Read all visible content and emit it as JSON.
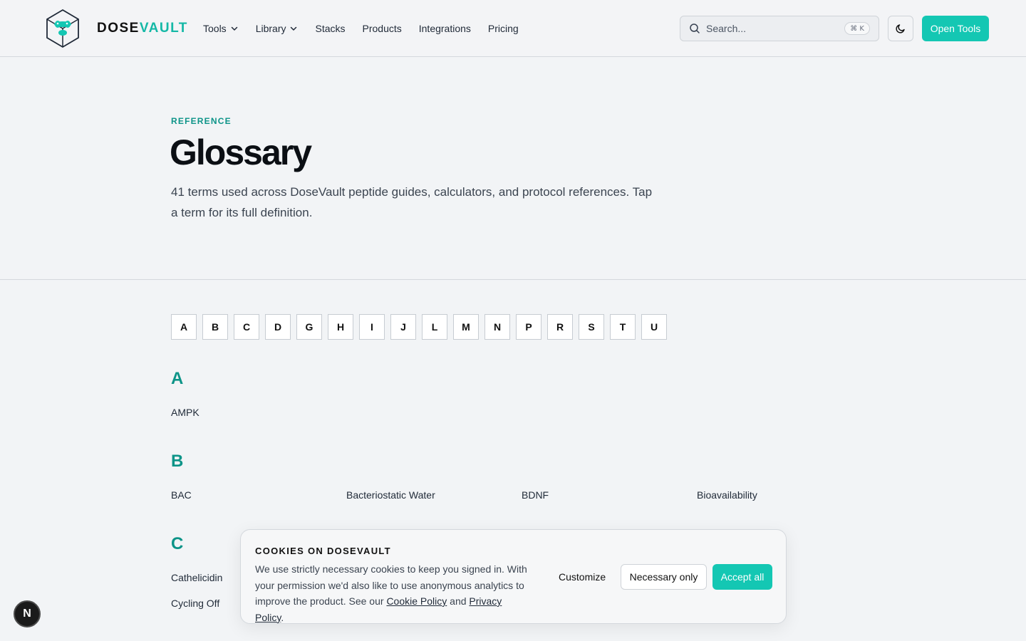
{
  "header": {
    "brand_part1": "DOSE",
    "brand_part2": "VAULT",
    "nav": [
      {
        "label": "Tools",
        "dropdown": true
      },
      {
        "label": "Library",
        "dropdown": true
      },
      {
        "label": "Stacks",
        "dropdown": false
      },
      {
        "label": "Products",
        "dropdown": false
      },
      {
        "label": "Integrations",
        "dropdown": false
      },
      {
        "label": "Pricing",
        "dropdown": false
      }
    ],
    "search_placeholder": "Search...",
    "search_shortcut": "⌘ K",
    "open_tools_label": "Open Tools"
  },
  "hero": {
    "eyebrow": "REFERENCE",
    "title": "Glossary",
    "description": "41 terms used across DoseVault peptide guides, calculators, and protocol references. Tap a term for its full definition."
  },
  "letters": [
    "A",
    "B",
    "C",
    "D",
    "G",
    "H",
    "I",
    "J",
    "L",
    "M",
    "N",
    "P",
    "R",
    "S",
    "T",
    "U"
  ],
  "sections": [
    {
      "letter": "A",
      "terms": [
        "AMPK"
      ]
    },
    {
      "letter": "B",
      "terms": [
        "BAC",
        "Bacteriostatic Water",
        "BDNF",
        "Bioavailability"
      ]
    },
    {
      "letter": "C",
      "terms": [
        "Cathelicidin",
        "Cycling Off"
      ]
    }
  ],
  "cookie": {
    "title": "COOKIES ON DOSEVAULT",
    "text_before": "We use strictly necessary cookies to keep you signed in. With your permission we'd also like to use anonymous analytics to improve the product. See our ",
    "cookie_policy_link": "Cookie Policy",
    "text_middle": " and ",
    "privacy_policy_link": "Privacy Policy",
    "text_after": ".",
    "customize_label": "Customize",
    "necessary_label": "Necessary only",
    "accept_label": "Accept all"
  },
  "dev_badge": "N",
  "colors": {
    "accent": "#14c7b3",
    "accent_dark": "#0d9488",
    "background": "#f2f4f6"
  }
}
